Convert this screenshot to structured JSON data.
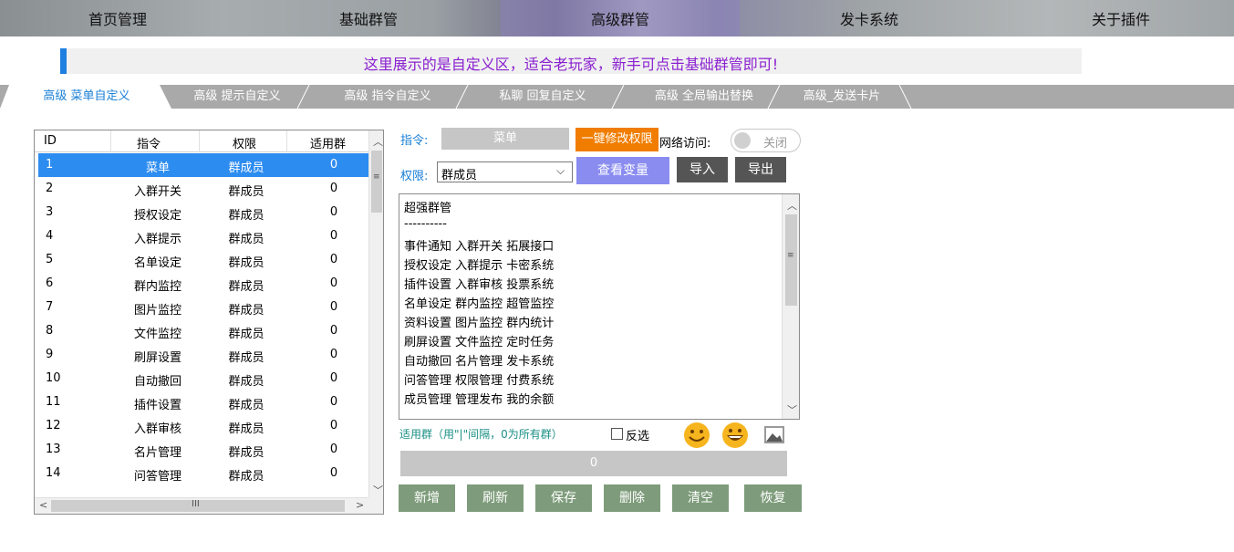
{
  "nav": {
    "items": [
      "首页管理",
      "基础群管",
      "高级群管",
      "发卡系统",
      "关于插件"
    ],
    "active_index": 2
  },
  "notice": "这里展示的是自定义区，适合老玩家，新手可点击基础群管即可!",
  "tabs": [
    "高级 菜单自定义",
    "高级 提示自定义",
    "高级 指令自定义",
    "私聊 回复自定义",
    "高级 全局输出替换",
    "高级_发送卡片"
  ],
  "active_tab": 0,
  "table": {
    "headers": [
      "ID",
      "指令",
      "权限",
      "适用群"
    ],
    "rows": [
      [
        "1",
        "菜单",
        "群成员",
        "0"
      ],
      [
        "2",
        "入群开关",
        "群成员",
        "0"
      ],
      [
        "3",
        "授权设定",
        "群成员",
        "0"
      ],
      [
        "4",
        "入群提示",
        "群成员",
        "0"
      ],
      [
        "5",
        "名单设定",
        "群成员",
        "0"
      ],
      [
        "6",
        "群内监控",
        "群成员",
        "0"
      ],
      [
        "7",
        "图片监控",
        "群成员",
        "0"
      ],
      [
        "8",
        "文件监控",
        "群成员",
        "0"
      ],
      [
        "9",
        "刷屏设置",
        "群成员",
        "0"
      ],
      [
        "10",
        "自动撤回",
        "群成员",
        "0"
      ],
      [
        "11",
        "插件设置",
        "群成员",
        "0"
      ],
      [
        "12",
        "入群审核",
        "群成员",
        "0"
      ],
      [
        "13",
        "名片管理",
        "群成员",
        "0"
      ],
      [
        "14",
        "问答管理",
        "群成员",
        "0"
      ]
    ],
    "selected_row": 0,
    "hscroll_thumb_glyph": "III"
  },
  "editor": {
    "command_label": "指令:",
    "command_value": "菜单",
    "modify_perm_button": "一键修改权限",
    "net_access_label": "网络访问:",
    "net_access_toggle": "关闭",
    "perm_label": "权限:",
    "perm_select_value": "群成员",
    "view_vars_button": "查看变量",
    "import_button": "导入",
    "export_button": "导出",
    "content_lines": [
      "超强群管",
      "----------",
      "事件通知 入群开关 拓展接口",
      "授权设定 入群提示 卡密系统",
      "插件设置 入群审核 投票系统",
      "名单设定 群内监控 超管监控",
      "资料设置 图片监控 群内统计",
      "刷屏设置 文件监控 定时任务",
      "自动撤回 名片管理 发卡系统",
      "问答管理 权限管理 付费系统",
      "成员管理 管理发布 我的余额"
    ],
    "group_label": "适用群（用\"|\"间隔，0为所有群）",
    "reverse_label": "反选",
    "group_value": "0",
    "buttons": [
      "新增",
      "刷新",
      "保存",
      "删除",
      "清空",
      "恢复"
    ]
  },
  "colors": {
    "accent_blue": "#1a7fd6",
    "notice_purple": "#8a1fd0",
    "orange": "#f07d00",
    "view_vars_purple": "#8a8cf0",
    "green_button": "#7e9c7b"
  }
}
